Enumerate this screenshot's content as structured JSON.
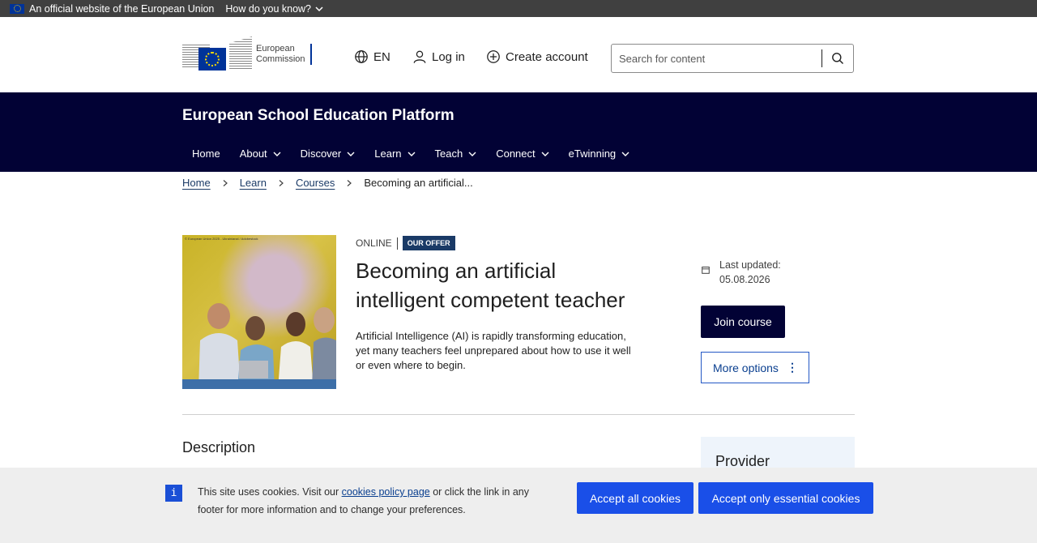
{
  "eu_strip": {
    "official_text": "An official website of the European Union",
    "how_know": "How do you know?"
  },
  "header": {
    "logo_line1": "European",
    "logo_line2": "Commission",
    "language": "EN",
    "login": "Log in",
    "create_account": "Create account",
    "search_placeholder": "Search for content"
  },
  "platform": {
    "title": "European School Education Platform",
    "nav": [
      {
        "label": "Home"
      },
      {
        "label": "About"
      },
      {
        "label": "Discover"
      },
      {
        "label": "Learn"
      },
      {
        "label": "Teach"
      },
      {
        "label": "Connect"
      },
      {
        "label": "eTwinning"
      }
    ]
  },
  "breadcrumb": {
    "items": [
      "Home",
      "Learn",
      "Courses"
    ],
    "current": "Becoming an artificial..."
  },
  "course": {
    "image_caption": "© European Union 2025 - Ukrainianal / Adobestock",
    "type": "ONLINE",
    "badge": "OUR OFFER",
    "title": "Becoming an artificial intelligent competent teacher",
    "description": "Artificial Intelligence (AI) is rapidly transforming education, yet many teachers feel unprepared about how to use it well or even where to begin.",
    "last_updated_label": "Last updated:",
    "last_updated_date": "05.08.2026",
    "join_label": "Join course",
    "more_options_label": "More options"
  },
  "sections": {
    "description_heading": "Description",
    "provider_heading": "Provider"
  },
  "cookie": {
    "text_before": "This site uses cookies. Visit our ",
    "link_text": "cookies policy page",
    "text_after": " or click the link in any footer for more information and to change your preferences.",
    "accept_all": "Accept all cookies",
    "accept_essential": "Accept only essential cookies"
  },
  "colors": {
    "platform_bg": "#020235",
    "accent_blue": "#1a4fe8",
    "badge_bg": "#1a3a66",
    "eu_strip_bg": "#404040"
  }
}
